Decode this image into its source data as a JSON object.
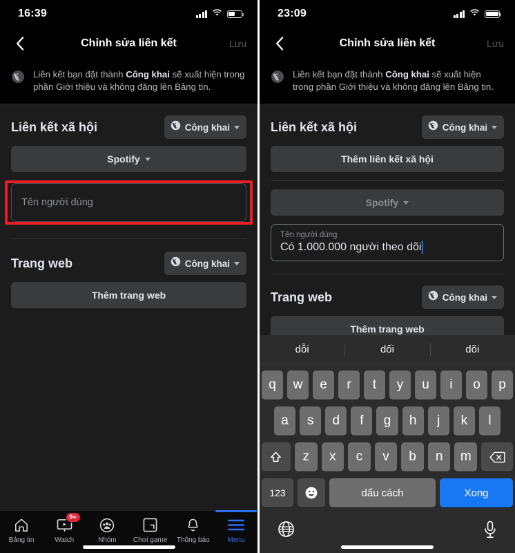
{
  "left": {
    "statusbar": {
      "time": "16:39",
      "battery_level": 50
    },
    "nav": {
      "back_icon": "chevron-left-icon",
      "title": "Chỉnh sửa liên kết",
      "save_label": "Lưu"
    },
    "info": {
      "icon": "globe-icon",
      "text_part1": "Liên kết bạn đặt thành ",
      "text_bold": "Công khai",
      "text_part2": " sẽ xuất hiện trong phần Giới thiệu và không đăng lên Bảng tin."
    },
    "social": {
      "title": "Liên kết xã hội",
      "privacy_label": "Công khai",
      "privacy_icon": "globe-icon",
      "platform_label": "Spotify",
      "username_placeholder": "Tên người dùng"
    },
    "website": {
      "title": "Trang web",
      "privacy_label": "Công khai",
      "privacy_icon": "globe-icon",
      "add_label": "Thêm trang web"
    },
    "tabbar": [
      {
        "label": "Bảng tin",
        "icon": "home-icon",
        "active": false,
        "badge": ""
      },
      {
        "label": "Watch",
        "icon": "watch-icon",
        "active": false,
        "badge": "9+"
      },
      {
        "label": "Nhóm",
        "icon": "groups-icon",
        "active": false,
        "badge": ""
      },
      {
        "label": "Chơi game",
        "icon": "gaming-icon",
        "active": false,
        "badge": ""
      },
      {
        "label": "Thông báo",
        "icon": "bell-icon",
        "active": false,
        "badge": ""
      },
      {
        "label": "Menu",
        "icon": "hamburger-icon",
        "active": true,
        "badge": ""
      }
    ]
  },
  "right": {
    "statusbar": {
      "time": "23:09",
      "battery_level": 100
    },
    "nav": {
      "back_icon": "chevron-left-icon",
      "title": "Chỉnh sửa liên kết",
      "save_label": "Lưu"
    },
    "info": {
      "icon": "globe-icon",
      "text_part1": "Liên kết bạn đặt thành ",
      "text_bold": "Công khai",
      "text_part2": " sẽ xuất hiện trong phần Giới thiệu và không đăng lên Bảng tin."
    },
    "social": {
      "title": "Liên kết xã hội",
      "privacy_label": "Công khai",
      "privacy_icon": "globe-icon",
      "add_social_label": "Thêm liên kết xã hội",
      "platform_label": "Spotify",
      "username_label": "Tên người dùng",
      "username_value": "Có 1.000.000 người theo dõi"
    },
    "website": {
      "title": "Trang web",
      "privacy_label": "Công khai",
      "privacy_icon": "globe-icon",
      "add_label": "Thêm trang web"
    },
    "keyboard": {
      "suggestions": [
        "dỗi",
        "dối",
        "dõi"
      ],
      "row1": [
        "q",
        "w",
        "e",
        "r",
        "t",
        "y",
        "u",
        "i",
        "o",
        "p"
      ],
      "row2": [
        "a",
        "s",
        "d",
        "f",
        "g",
        "h",
        "j",
        "k",
        "l"
      ],
      "row3": [
        "z",
        "x",
        "c",
        "v",
        "b",
        "n",
        "m"
      ],
      "shift_icon": "shift-icon",
      "backspace_icon": "backspace-icon",
      "numbers_label": "123",
      "emoji_icon": "emoji-icon",
      "space_label": "dấu cách",
      "done_label": "Xong",
      "globe_icon": "globe-icon",
      "mic_icon": "microphone-icon"
    }
  },
  "colors": {
    "accent_blue": "#1877f2",
    "highlight_red": "#ee1c25",
    "badge_red": "#e4263c",
    "surface": "#1c1c1d",
    "control": "#3a3b3c"
  }
}
